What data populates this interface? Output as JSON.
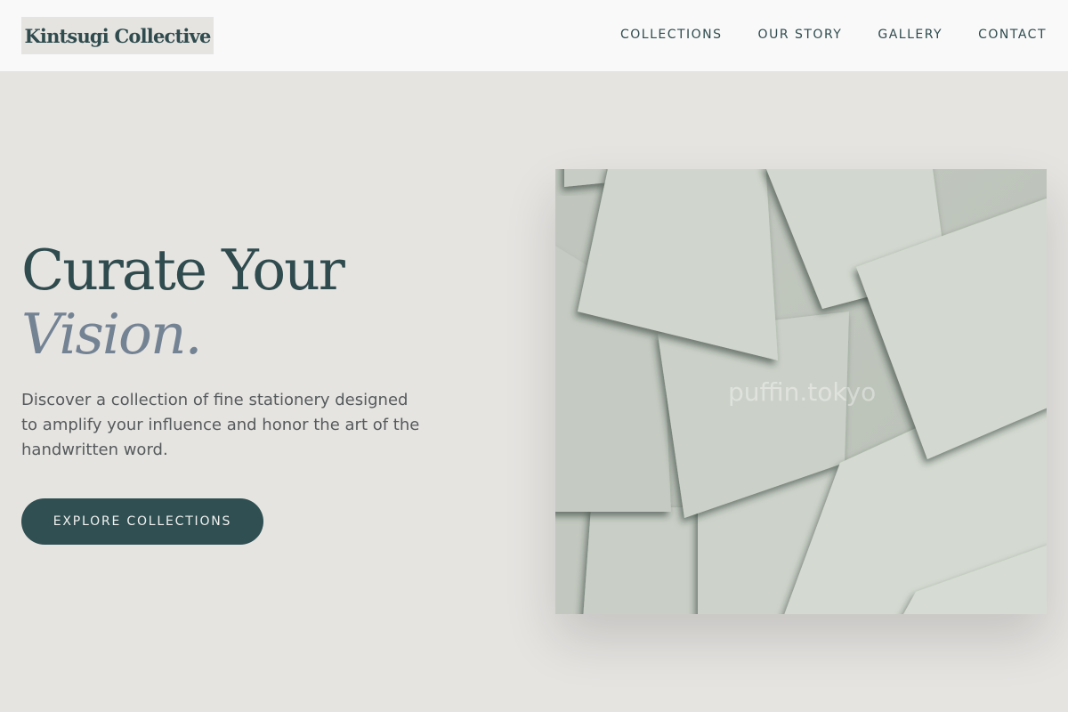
{
  "header": {
    "brand": "Kintsugi Collective",
    "nav": [
      "COLLECTIONS",
      "OUR STORY",
      "GALLERY",
      "CONTACT"
    ]
  },
  "hero": {
    "title_line1": "Curate Your",
    "title_line2": "Vision.",
    "description": "Discover a collection of fine stationery designed to amplify your influence and honor the art of the handwritten word.",
    "cta": "EXPLORE COLLECTIONS"
  },
  "image": {
    "subject": "layered paper cards",
    "watermark": "puffin.tokyo"
  },
  "colors": {
    "accent": "#2f4f52",
    "muted_title": "#748394",
    "background": "#e6e4e1",
    "header": "#f9f9f9"
  }
}
